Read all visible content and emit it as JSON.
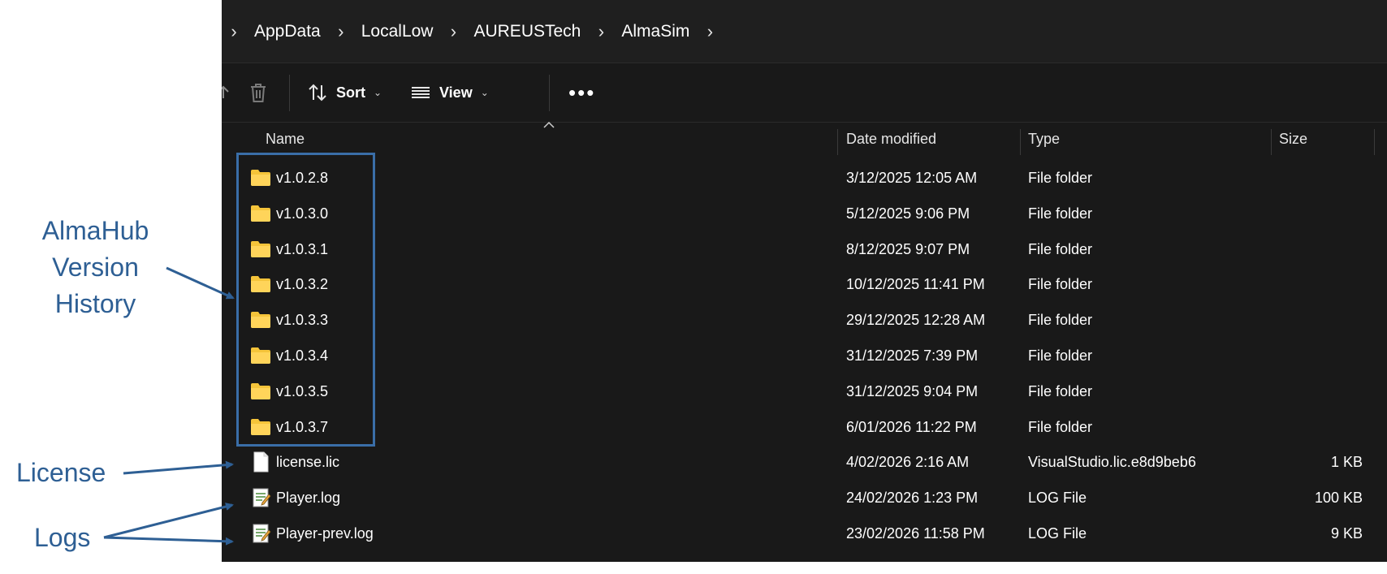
{
  "breadcrumb": {
    "items": [
      "AppData",
      "LocalLow",
      "AUREUSTech",
      "AlmaSim"
    ]
  },
  "toolbar": {
    "sort_label": "Sort",
    "view_label": "View"
  },
  "columns": {
    "name": "Name",
    "date": "Date modified",
    "type": "Type",
    "size": "Size"
  },
  "rows": [
    {
      "name": "v1.0.2.8",
      "date": "3/12/2025 12:05 AM",
      "type": "File folder",
      "size": "",
      "icon": "folder-icon"
    },
    {
      "name": "v1.0.3.0",
      "date": "5/12/2025 9:06 PM",
      "type": "File folder",
      "size": "",
      "icon": "folder-icon"
    },
    {
      "name": "v1.0.3.1",
      "date": "8/12/2025 9:07 PM",
      "type": "File folder",
      "size": "",
      "icon": "folder-icon"
    },
    {
      "name": "v1.0.3.2",
      "date": "10/12/2025 11:41 PM",
      "type": "File folder",
      "size": "",
      "icon": "folder-icon"
    },
    {
      "name": "v1.0.3.3",
      "date": "29/12/2025 12:28 AM",
      "type": "File folder",
      "size": "",
      "icon": "folder-icon"
    },
    {
      "name": "v1.0.3.4",
      "date": "31/12/2025 7:39 PM",
      "type": "File folder",
      "size": "",
      "icon": "folder-icon"
    },
    {
      "name": "v1.0.3.5",
      "date": "31/12/2025 9:04 PM",
      "type": "File folder",
      "size": "",
      "icon": "folder-icon"
    },
    {
      "name": "v1.0.3.7",
      "date": "6/01/2026 11:22 PM",
      "type": "File folder",
      "size": "",
      "icon": "folder-icon"
    },
    {
      "name": "license.lic",
      "date": "4/02/2026 2:16 AM",
      "type": "VisualStudio.lic.e8d9beb6",
      "size": "1 KB",
      "icon": "file-icon"
    },
    {
      "name": "Player.log",
      "date": "24/02/2026 1:23 PM",
      "type": "LOG File",
      "size": "100 KB",
      "icon": "log-file-icon"
    },
    {
      "name": "Player-prev.log",
      "date": "23/02/2026 11:58 PM",
      "type": "LOG File",
      "size": "9 KB",
      "icon": "log-file-icon"
    }
  ],
  "annotations": {
    "version_history_lines": [
      "AlmaHub",
      "Version",
      "History"
    ],
    "license": "License",
    "logs": "Logs"
  },
  "colors": {
    "annotation": "#2e5f94",
    "folder": "#f5c43a",
    "background": "#191919"
  }
}
